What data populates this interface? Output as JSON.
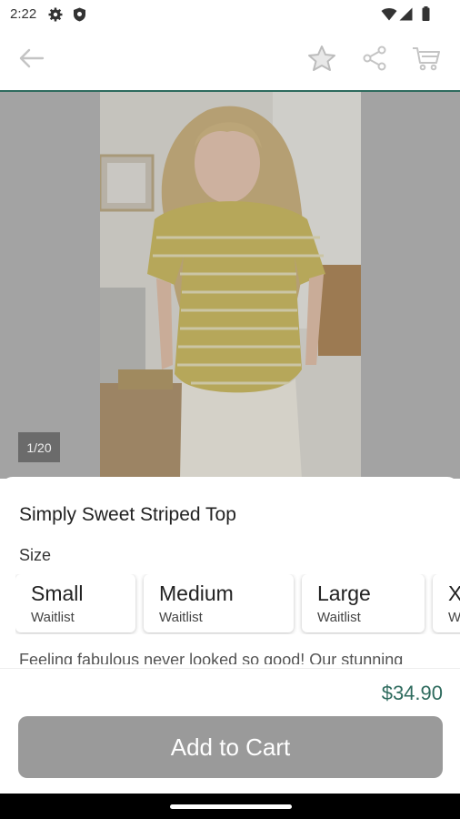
{
  "status_bar": {
    "time": "2:22",
    "icons": [
      "gear-icon",
      "shield-icon",
      "wifi-icon",
      "cell-signal-icon",
      "battery-icon"
    ]
  },
  "app_bar": {
    "icons": [
      "back-arrow-icon",
      "star-icon",
      "share-icon",
      "cart-icon"
    ]
  },
  "gallery": {
    "counter": "1/20"
  },
  "product": {
    "title": "Simply Sweet Striped Top",
    "size_label": "Size",
    "sizes": [
      {
        "name": "Small",
        "status": "Waitlist"
      },
      {
        "name": "Medium",
        "status": "Waitlist"
      },
      {
        "name": "Large",
        "status": "Waitlist"
      },
      {
        "name": "X",
        "status": "W"
      }
    ],
    "description": "Feeling fabulous never looked so good! Our stunning",
    "price": "$34.90",
    "add_to_cart_label": "Add to Cart"
  },
  "colors": {
    "accent": "#2e6b5e",
    "button_disabled": "#9a9a9a"
  }
}
